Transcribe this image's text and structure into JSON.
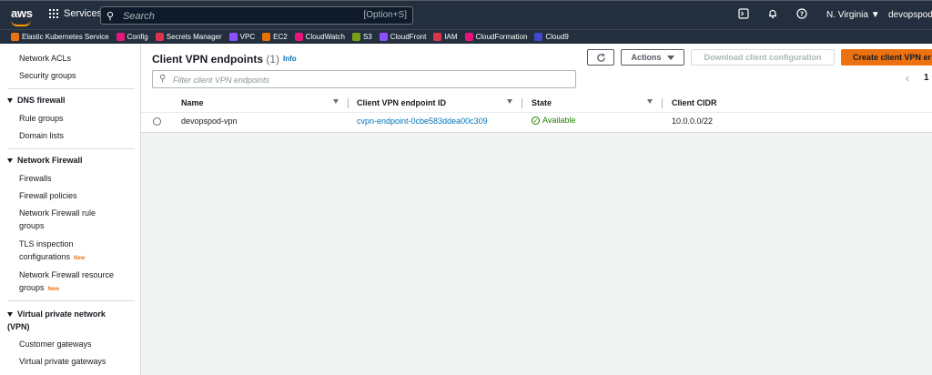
{
  "topnav": {
    "logo": "aws",
    "services_label": "Services",
    "search_placeholder": "Search",
    "search_shortcut": "[Option+S]",
    "region": "N. Virginia ▼",
    "account": "devopspod @"
  },
  "favorites": [
    {
      "label": "Elastic Kubernetes Service",
      "color": "#ec7211"
    },
    {
      "label": "Config",
      "color": "#e7157b"
    },
    {
      "label": "Secrets Manager",
      "color": "#dd344c"
    },
    {
      "label": "VPC",
      "color": "#8c4fff"
    },
    {
      "label": "EC2",
      "color": "#ed7100"
    },
    {
      "label": "CloudWatch",
      "color": "#e7157b"
    },
    {
      "label": "S3",
      "color": "#7aa116"
    },
    {
      "label": "CloudFront",
      "color": "#8c4fff"
    },
    {
      "label": "IAM",
      "color": "#dd344c"
    },
    {
      "label": "CloudFormation",
      "color": "#e7157b"
    },
    {
      "label": "Cloud9",
      "color": "#3f48cc"
    }
  ],
  "sidebar": {
    "items": {
      "network_acls": "Network ACLs",
      "security_groups": "Security groups",
      "dns_firewall": "DNS firewall",
      "rule_groups": "Rule groups",
      "domain_lists": "Domain lists",
      "network_firewall": "Network Firewall",
      "firewalls": "Firewalls",
      "firewall_policies": "Firewall policies",
      "nf_rule_groups": "Network Firewall rule groups",
      "tls_inspection": "TLS inspection configurations",
      "nf_resource_groups": "Network Firewall resource groups",
      "vpn": "Virtual private network (VPN)",
      "customer_gateways": "Customer gateways",
      "virtual_private_gateways": "Virtual private gateways"
    },
    "new_badge": "New"
  },
  "main": {
    "title": "Client VPN endpoints",
    "count": "(1)",
    "info": "Info",
    "refresh_icon": "refresh-icon",
    "actions_label": "Actions",
    "download_label": "Download client configuration",
    "create_label": "Create client VPN endpoint",
    "filter_placeholder": "Filter client VPN endpoints",
    "page_number": "1",
    "columns": [
      "Name",
      "Client VPN endpoint ID",
      "State",
      "Client CIDR"
    ],
    "rows": [
      {
        "name": "devopspod-vpn",
        "endpoint_id": "cvpn-endpoint-0cbe583ddea00c309",
        "state": "Available",
        "cidr": "10.0.0.0/22"
      }
    ]
  }
}
